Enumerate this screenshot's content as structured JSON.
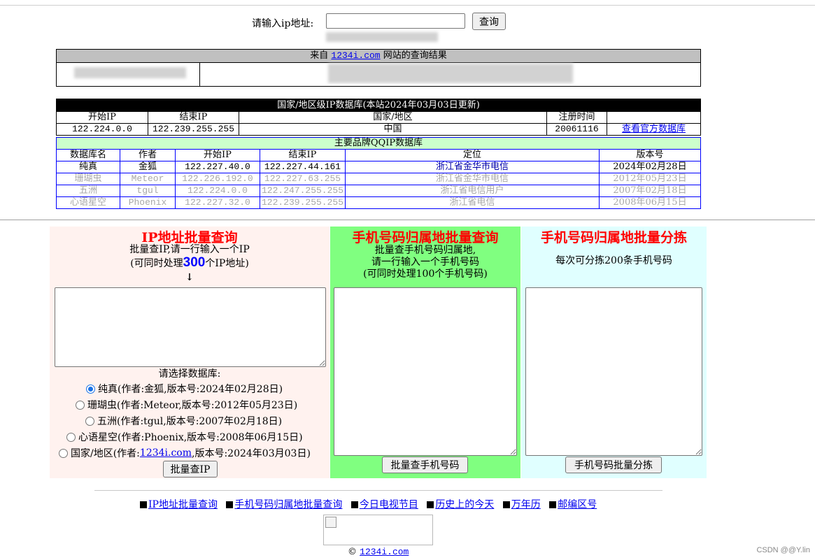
{
  "query": {
    "label": "请输入ip地址:",
    "input_value": "",
    "button": "查询"
  },
  "result": {
    "prefix": "来自",
    "site": "1234i.com",
    "suffix": "网站的查询结果"
  },
  "national_db": {
    "title": "国家/地区级IP数据库(本站2024年03月03日更新)",
    "headers": [
      "开始IP",
      "结束IP",
      "国家/地区",
      "注册时间",
      ""
    ],
    "row": [
      "122.224.0.0",
      "122.239.255.255",
      "中国",
      "20061116"
    ],
    "link": "查看官方数据库"
  },
  "qqip_db": {
    "title": "主要品牌QQIP数据库",
    "headers": [
      "数据库名",
      "作者",
      "开始IP",
      "结束IP",
      "定位",
      "版本号"
    ],
    "rows": [
      [
        "纯真",
        "金狐",
        "122.227.40.0",
        "122.227.44.161",
        "浙江省金华市电信",
        "2024年02月28日"
      ],
      [
        "珊瑚虫",
        "Meteor",
        "122.226.192.0",
        "122.227.63.255",
        "浙江省金华市电信",
        "2012年05月23日"
      ],
      [
        "五洲",
        "tgul",
        "122.224.0.0",
        "122.247.255.255",
        "浙江省电信用户",
        "2007年02月18日"
      ],
      [
        "心语星空",
        "Phoenix",
        "122.227.32.0",
        "122.239.255.255",
        "浙江省电信",
        "2008年06月15日"
      ]
    ]
  },
  "panel_ip": {
    "title": "IP地址批量查询",
    "line1": "批量查IP,请一行输入一个IP",
    "line2_pre": "(可同时处理",
    "line2_num": "300",
    "line2_post": "个IP地址)",
    "arrow": "↓",
    "select_label": "请选择数据库:",
    "options": [
      "纯真(作者:金狐,版本号:2024年02月28日)",
      "珊瑚虫(作者:Meteor,版本号:2012年05月23日)",
      "五洲(作者:tgul,版本号:2007年02月18日)",
      "心语星空(作者:Phoenix,版本号:2008年06月15日)"
    ],
    "option5_pre": "国家/地区(作者:",
    "option5_link": "1234i.com",
    "option5_post": ",版本号:2024年03月03日)",
    "button": "批量查IP"
  },
  "panel_phone": {
    "title": "手机号码归属地批量查询",
    "line1": "批量查手机号码归属地,",
    "line2": "请一行输入一个手机号码",
    "line3": "(可同时处理100个手机号码)",
    "button": "批量查手机号码"
  },
  "panel_sort": {
    "title": "手机号码归属地批量分拣",
    "line1": "每次可分拣200条手机号码",
    "button": "手机号码批量分拣"
  },
  "footer": {
    "links": [
      "IP地址批量查询",
      "手机号码归属地批量查询",
      "今日电视节目",
      "历史上的今天",
      "万年历",
      "邮编区号"
    ],
    "copy_symbol": "©",
    "copy_link": "1234i.com"
  },
  "watermark": "CSDN @@Y.lin"
}
